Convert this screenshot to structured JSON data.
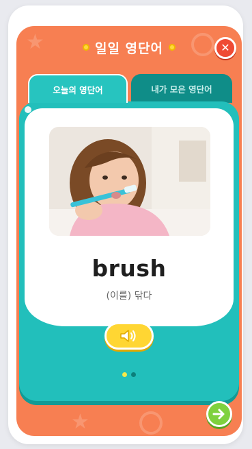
{
  "header": {
    "title": "일일 영단어",
    "close_icon": "close-icon"
  },
  "tabs": [
    {
      "label": "오늘의 영단어",
      "active": true
    },
    {
      "label": "내가 모은 영단어",
      "active": false
    }
  ],
  "card": {
    "image": "girl-brushing-teeth",
    "word": "brush",
    "meaning": "(이를) 닦다",
    "sound_icon": "speaker-icon"
  },
  "pager": {
    "total": 2,
    "current": 1
  },
  "footer": {
    "next_icon": "arrow-right-icon"
  },
  "colors": {
    "background": "#f77f52",
    "teal": "#22bfbb",
    "teal_dark": "#0f8d88",
    "close": "#ef4a34",
    "sound": "#ffd633",
    "next": "#7fd13e"
  }
}
